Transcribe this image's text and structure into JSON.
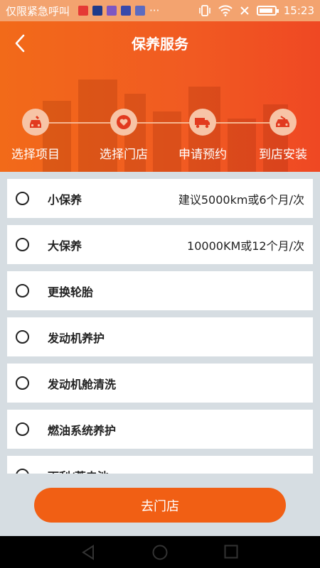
{
  "statusbar": {
    "carrier": "仅限紧急呼叫",
    "time": "15:23",
    "more": "···",
    "notif_colors": [
      "#e53935",
      "#1e3a8a",
      "#7e57c2",
      "#3949ab",
      "#5c6bc0"
    ]
  },
  "header": {
    "title": "保养服务",
    "back_icon": "chevron-left-icon"
  },
  "steps": [
    {
      "label": "选择项目",
      "icon": "wrench-car-icon"
    },
    {
      "label": "选择门店",
      "icon": "heart-icon"
    },
    {
      "label": "申请预约",
      "icon": "truck-icon"
    },
    {
      "label": "到店安装",
      "icon": "car-service-icon"
    }
  ],
  "services": [
    {
      "name": "小保养",
      "note": "建议5000km或6个月/次"
    },
    {
      "name": "大保养",
      "note": "10000KM或12个月/次"
    },
    {
      "name": "更换轮胎",
      "note": ""
    },
    {
      "name": "发动机养护",
      "note": ""
    },
    {
      "name": "发动机舱清洗",
      "note": ""
    },
    {
      "name": "燃油系统养护",
      "note": ""
    },
    {
      "name": "雨刮/蓄电池",
      "note": ""
    }
  ],
  "action": {
    "go_label": "去门店"
  },
  "colors": {
    "accent": "#f15f14",
    "header_start": "#f26a19",
    "header_end": "#ef4823",
    "background": "#d6dde2"
  }
}
